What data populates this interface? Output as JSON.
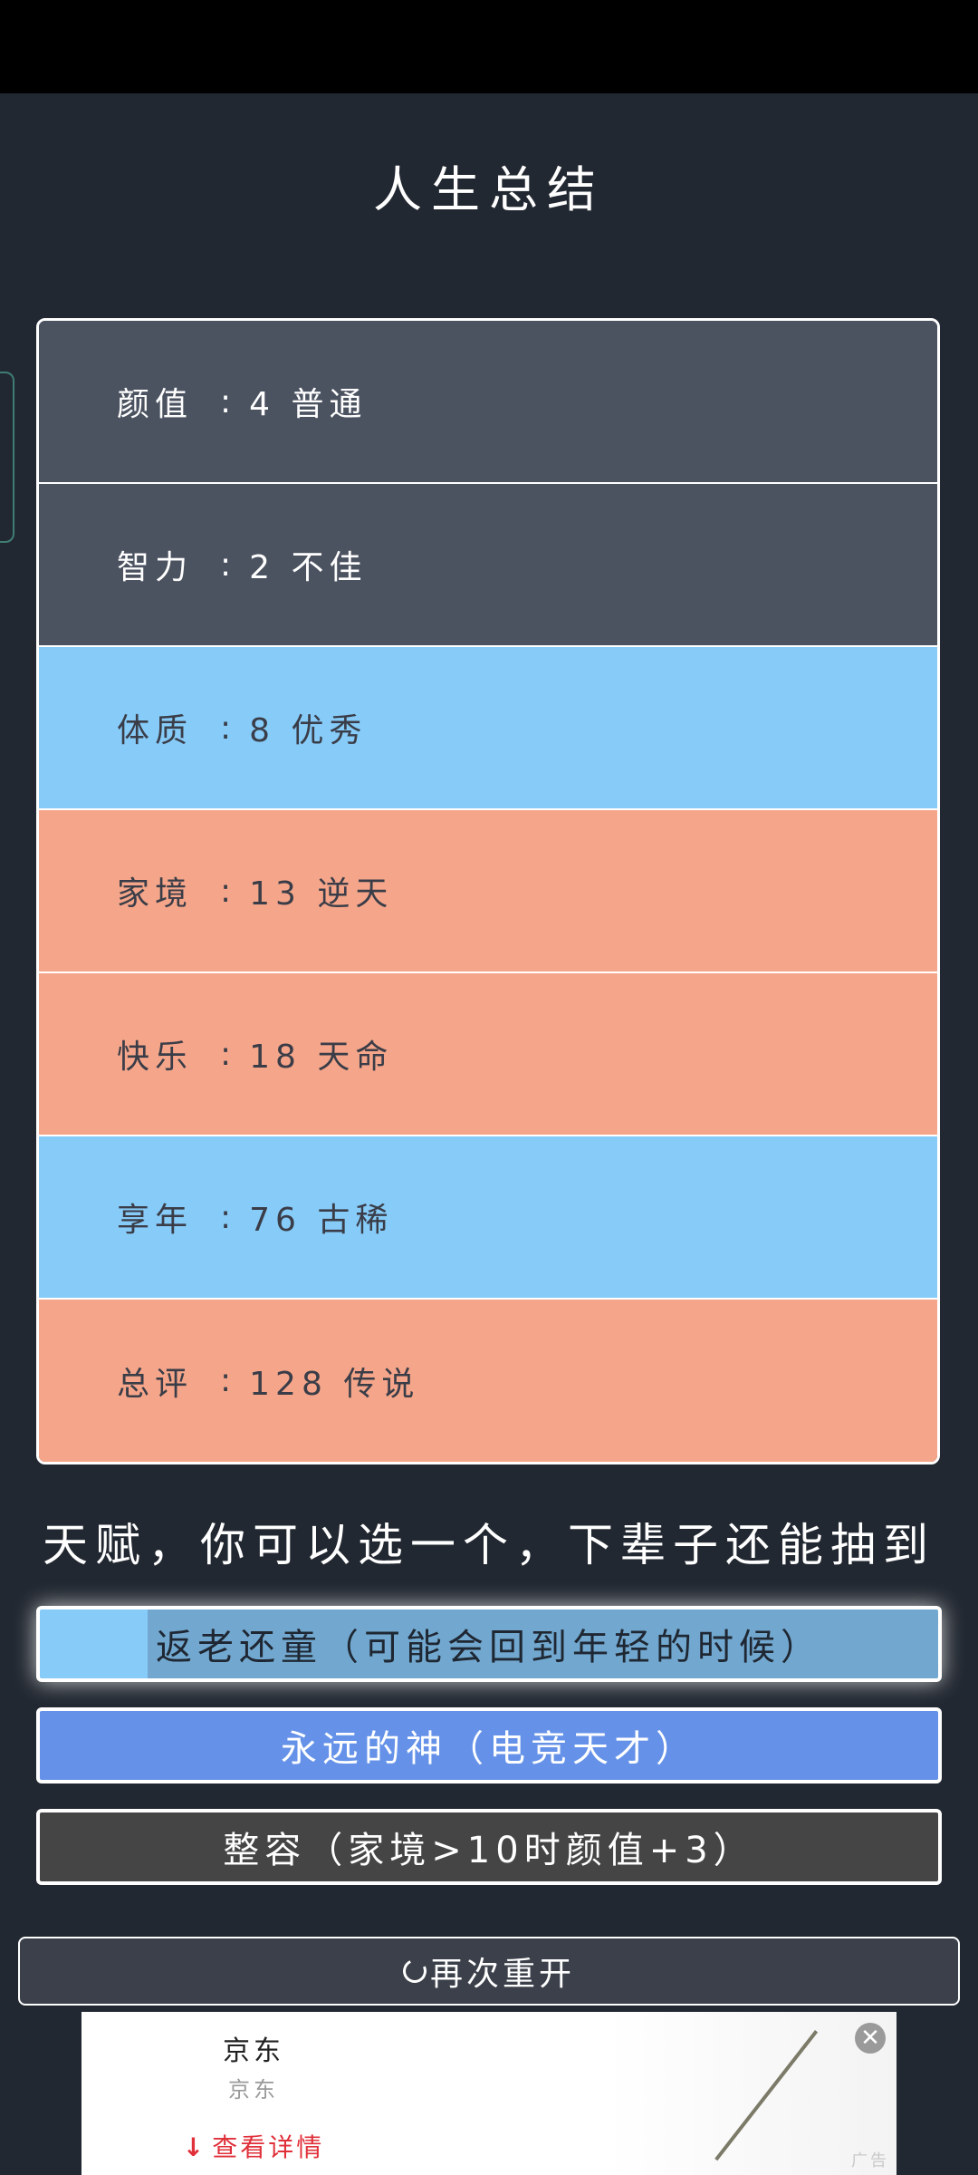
{
  "title": "人生总结",
  "summary": {
    "rows": [
      {
        "label": "颜值",
        "value": "4 普通"
      },
      {
        "label": "智力",
        "value": "2 不佳"
      },
      {
        "label": "体质",
        "value": "8 优秀"
      },
      {
        "label": "家境",
        "value": "13 逆天"
      },
      {
        "label": "快乐",
        "value": "18 天命"
      },
      {
        "label": "享年",
        "value": "76 古稀"
      },
      {
        "label": "总评",
        "value": "128 传说"
      }
    ],
    "separator": ":"
  },
  "talents": {
    "heading": "天赋，你可以选一个，下辈子还能抽到",
    "options": [
      "返老还童（可能会回到年轻的时候）",
      "永远的神（电竞天才）",
      "整容（家境>10时颜值+3）"
    ]
  },
  "restart_label": "再次重开",
  "ad": {
    "title": "京东",
    "subtitle": "京东",
    "cta": "查看详情",
    "label": "广告",
    "close_icon": "close-icon"
  },
  "colors": {
    "background": "#222831",
    "gray": "#4b5260",
    "blue": "#87cbf8",
    "orange": "#f5a68a",
    "talent_blue": "#6592e8",
    "talent_dark": "#454545"
  }
}
